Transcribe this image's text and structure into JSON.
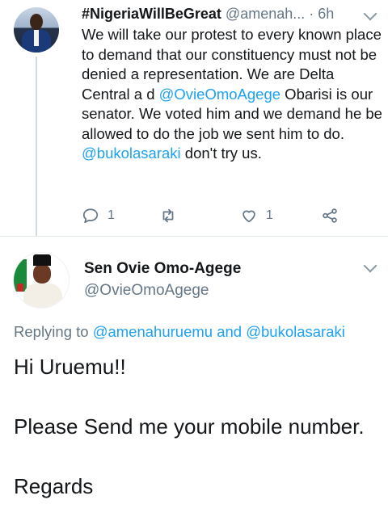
{
  "tweet1": {
    "name": "#NigeriaWillBeGreat",
    "handle": "@amenah...",
    "time": "· 6h",
    "text_parts": [
      "We will take our protest to every known place to demand that our constituency must not be denied a representation. We are Delta Central a d ",
      "@OvieOmoAgege",
      " Obarisi is our senator. We voted him and we demand he be allowed to do the job we sent him to do. ",
      "@bukolasaraki",
      " don't try us."
    ],
    "reply_count": "1",
    "like_count": "1"
  },
  "tweet2": {
    "name": "Sen Ovie Omo-Agege",
    "handle": "@OvieOmoAgege",
    "replying_prefix": "Replying to ",
    "replying_to": "@amenahuruemu and @bukolasaraki",
    "lines": [
      "Hi Uruemu!!",
      "Please Send me your mobile number.",
      "Regards"
    ]
  },
  "colors": {
    "link": "#1da1f2",
    "muted": "#657786",
    "text": "#14171a"
  },
  "icons": [
    "reply-icon",
    "retweet-icon",
    "like-icon",
    "share-icon",
    "chevron-down-icon"
  ]
}
